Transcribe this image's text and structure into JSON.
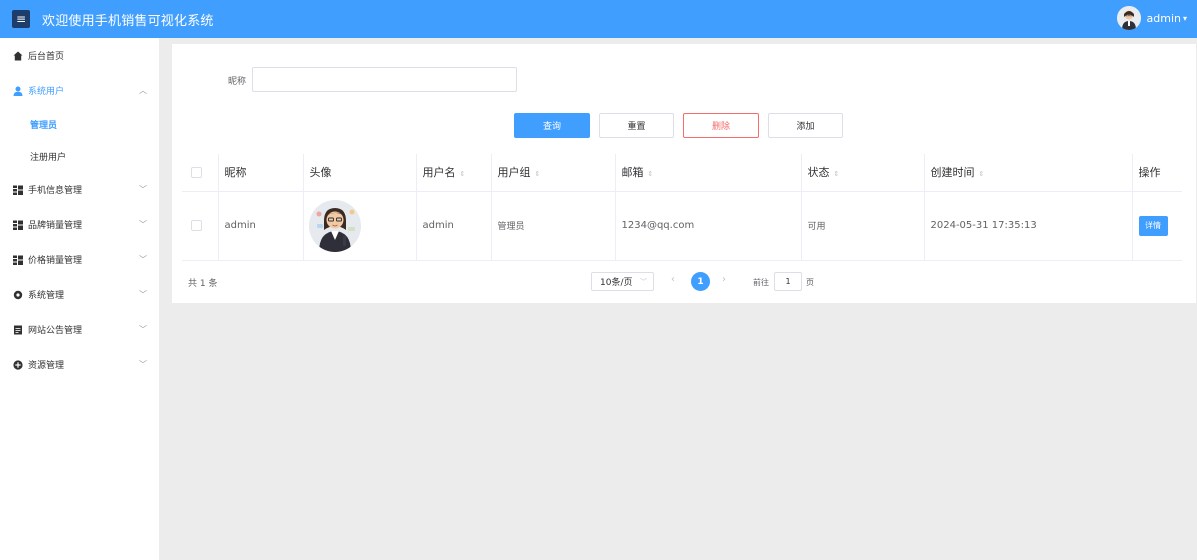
{
  "header": {
    "menu_icon": "hamburger-icon",
    "title": "欢迎使用手机销售可视化系统",
    "user_label": "admin",
    "user_dropdown_icon": "chevron-down-icon",
    "brand_color": "#409eff"
  },
  "sidebar": {
    "items": [
      {
        "label": "后台首页",
        "icon": "home-icon"
      },
      {
        "label": "系统用户",
        "icon": "user-icon",
        "expanded": true,
        "children": [
          {
            "label": "管理员",
            "active": true
          },
          {
            "label": "注册用户"
          }
        ]
      },
      {
        "label": "手机信息管理",
        "icon": "grid-icon"
      },
      {
        "label": "品牌销量管理",
        "icon": "grid-icon"
      },
      {
        "label": "价格销量管理",
        "icon": "grid-icon"
      },
      {
        "label": "系统管理",
        "icon": "gear-icon"
      },
      {
        "label": "网站公告管理",
        "icon": "document-icon"
      },
      {
        "label": "资源管理",
        "icon": "plus-circle-icon"
      }
    ]
  },
  "search": {
    "label": "昵称",
    "value": "",
    "placeholder": ""
  },
  "actions": {
    "query": "查询",
    "reset": "重置",
    "delete": "删除",
    "add": "添加"
  },
  "table": {
    "headers": [
      "昵称",
      "头像",
      "用户名",
      "用户组",
      "邮箱",
      "状态",
      "创建时间",
      "操作"
    ],
    "rows": [
      {
        "nickname": "admin",
        "avatar": "avatar-image",
        "username": "admin",
        "group": "管理员",
        "email": "1234@qq.com",
        "status": "可用",
        "created": "2024-05-31 17:35:13",
        "action": "详情"
      }
    ]
  },
  "pagination": {
    "total_text": "共 1 条",
    "page_size": "10条/页",
    "current_page": "1",
    "goto_label": "前往",
    "goto_value": "1",
    "goto_suffix": "页"
  }
}
